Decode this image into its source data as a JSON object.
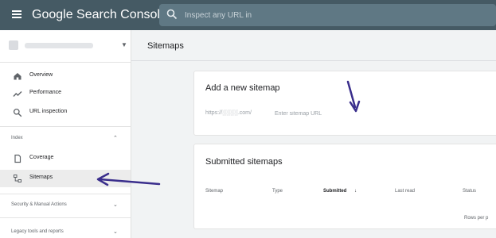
{
  "topbar": {
    "app_title": "Google Search Console",
    "search_placeholder": "Inspect any URL in"
  },
  "sidebar": {
    "nav": [
      {
        "label": "Overview",
        "icon": "home-icon"
      },
      {
        "label": "Performance",
        "icon": "trending-up-icon"
      },
      {
        "label": "URL inspection",
        "icon": "search-icon"
      }
    ],
    "index_section": "Index",
    "index_items": [
      {
        "label": "Coverage",
        "icon": "file-icon"
      },
      {
        "label": "Sitemaps",
        "icon": "sitemap-icon",
        "active": true
      }
    ],
    "security_section": "Security & Manual Actions",
    "legacy_section": "Legacy tools and reports"
  },
  "main": {
    "page_title": "Sitemaps",
    "add_card": {
      "title": "Add a new sitemap",
      "url_prefix": "https://░░░░.com/",
      "input_placeholder": "Enter sitemap URL"
    },
    "submitted_card": {
      "title": "Submitted sitemaps",
      "columns": [
        "Sitemap",
        "Type",
        "Submitted",
        "Last read",
        "Status"
      ],
      "sorted_column": "Submitted",
      "rows_per_page": "Rows per p"
    }
  },
  "colors": {
    "topbar": "#455a64",
    "active_nav": "#ececec",
    "annotation_arrow": "#3a2e8c"
  }
}
